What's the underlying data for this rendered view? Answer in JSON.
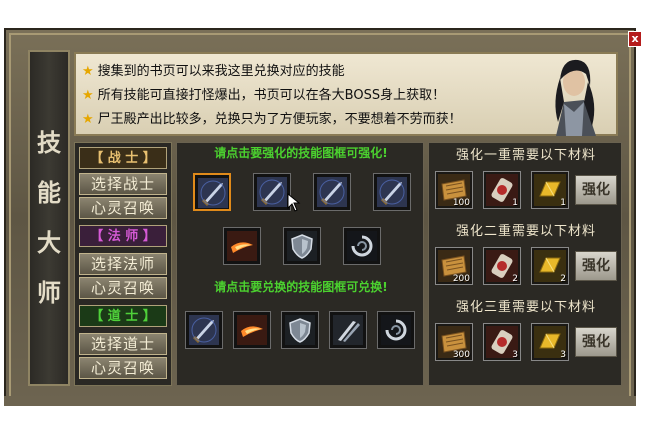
{
  "window": {
    "title_chars": [
      "技",
      "能",
      "大",
      "师"
    ],
    "close_label": "x"
  },
  "notice": {
    "lines": [
      "搜集到的书页可以来我这里兑换对应的技能",
      "所有技能可直接打怪爆出，书页可以在各大BOSS身上获取！",
      "尸王殿产出比较多，兑换只为了方便玩家，不要想着不劳而获！"
    ],
    "star_icon": "star-icon"
  },
  "classes": [
    {
      "header": "【 战 士 】",
      "header_color": "#e8c070",
      "header_bg": "#3a2e18",
      "buttons": [
        "选择战士",
        "心灵召唤"
      ]
    },
    {
      "header": "【 法 师 】",
      "header_color": "#d65ad6",
      "header_bg": "#3a1f3a",
      "buttons": [
        "选择法师",
        "心灵召唤"
      ]
    },
    {
      "header": "【 道 士 】",
      "header_color": "#4fd13a",
      "header_bg": "#1b3a17",
      "buttons": [
        "选择道士",
        "心灵召唤"
      ]
    }
  ],
  "center": {
    "strengthen_hint": "请点击要强化的技能图框可强化!",
    "exchange_hint": "请点击要兑换的技能图框可兑换!",
    "strengthen_skills": [
      "sword-skill-icon",
      "sword-skill-icon",
      "sword-skill-icon",
      "sword-skill-icon",
      "fire-slash-skill-icon",
      "shield-skill-icon",
      "whirl-skill-icon"
    ],
    "exchange_skills": [
      "sword-skill-icon",
      "fire-slash-skill-icon",
      "shield-skill-icon",
      "double-blade-skill-icon",
      "whirl-skill-icon"
    ]
  },
  "tiers": [
    {
      "title": "强化一重需要以下材料",
      "materials": [
        {
          "icon": "book-page-icon",
          "count": "100"
        },
        {
          "icon": "scroll-icon",
          "count": "1"
        },
        {
          "icon": "gold-bar-icon",
          "count": "1"
        }
      ],
      "button": "强化"
    },
    {
      "title": "强化二重需要以下材料",
      "materials": [
        {
          "icon": "book-page-icon",
          "count": "200"
        },
        {
          "icon": "scroll-icon",
          "count": "2"
        },
        {
          "icon": "gold-bar-icon",
          "count": "2"
        }
      ],
      "button": "强化"
    },
    {
      "title": "强化三重需要以下材料",
      "materials": [
        {
          "icon": "book-page-icon",
          "count": "300"
        },
        {
          "icon": "scroll-icon",
          "count": "3"
        },
        {
          "icon": "gold-bar-icon",
          "count": "3"
        }
      ],
      "button": "强化"
    }
  ]
}
